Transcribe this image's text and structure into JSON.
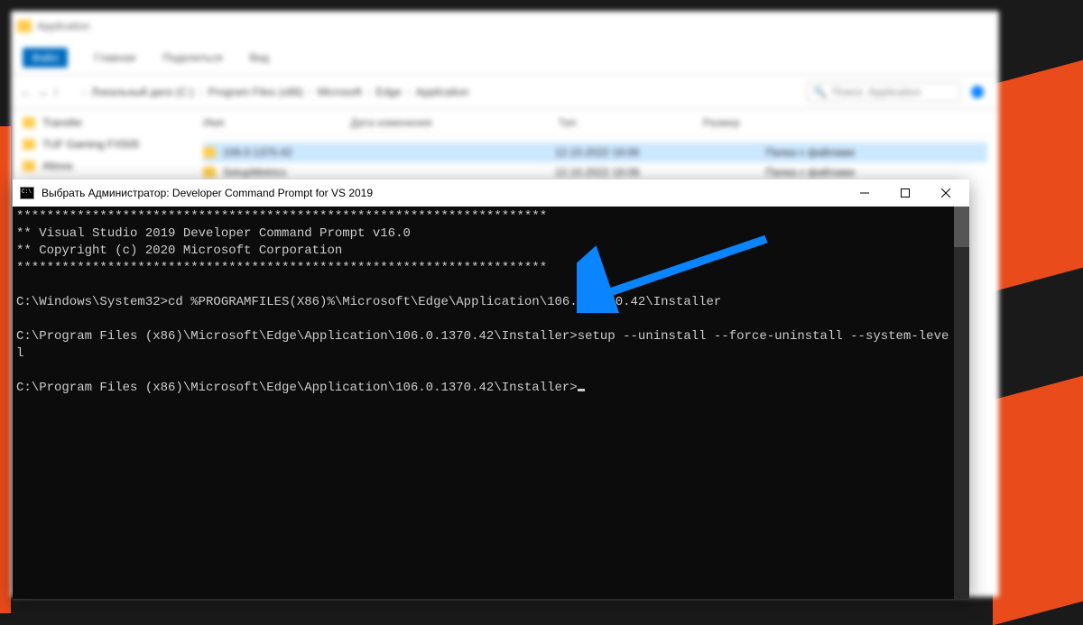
{
  "explorer": {
    "title": "Application",
    "ribbon": {
      "file": "Файл",
      "home": "Главная",
      "share": "Поделиться",
      "view": "Вид"
    },
    "breadcrumbs": [
      "Локальный диск (C:)",
      "Program Files (x86)",
      "Microsoft",
      "Edge",
      "Application"
    ],
    "search_placeholder": "Поиск: Application",
    "columns": [
      "Имя",
      "Дата изменения",
      "Тип",
      "Размер"
    ],
    "sidebar_items": [
      "Transfer",
      "TUF Gaming FX505",
      "Altova"
    ],
    "rows": [
      {
        "name": "106.0.1370.42",
        "date": "12.10.2022 16:06",
        "type": "Папка с файлами"
      },
      {
        "name": "SetupMetrics",
        "date": "12.10.2022 16:06",
        "type": "Папка с файлами"
      }
    ]
  },
  "cmd": {
    "title": "Выбрать Администратор: Developer Command Prompt for VS 2019",
    "lines": {
      "stars": "**********************************************************************",
      "banner1": "** Visual Studio 2019 Developer Command Prompt v16.0",
      "banner2": "** Copyright (c) 2020 Microsoft Corporation",
      "prompt1": "C:\\Windows\\System32>cd %PROGRAMFILES(X86)%\\Microsoft\\Edge\\Application\\106.0.1370.42\\Installer",
      "prompt2": "C:\\Program Files (x86)\\Microsoft\\Edge\\Application\\106.0.1370.42\\Installer>setup --uninstall --force-uninstall --system-level",
      "prompt3": "C:\\Program Files (x86)\\Microsoft\\Edge\\Application\\106.0.1370.42\\Installer>"
    }
  },
  "colors": {
    "arrow": "#0a84ff"
  }
}
